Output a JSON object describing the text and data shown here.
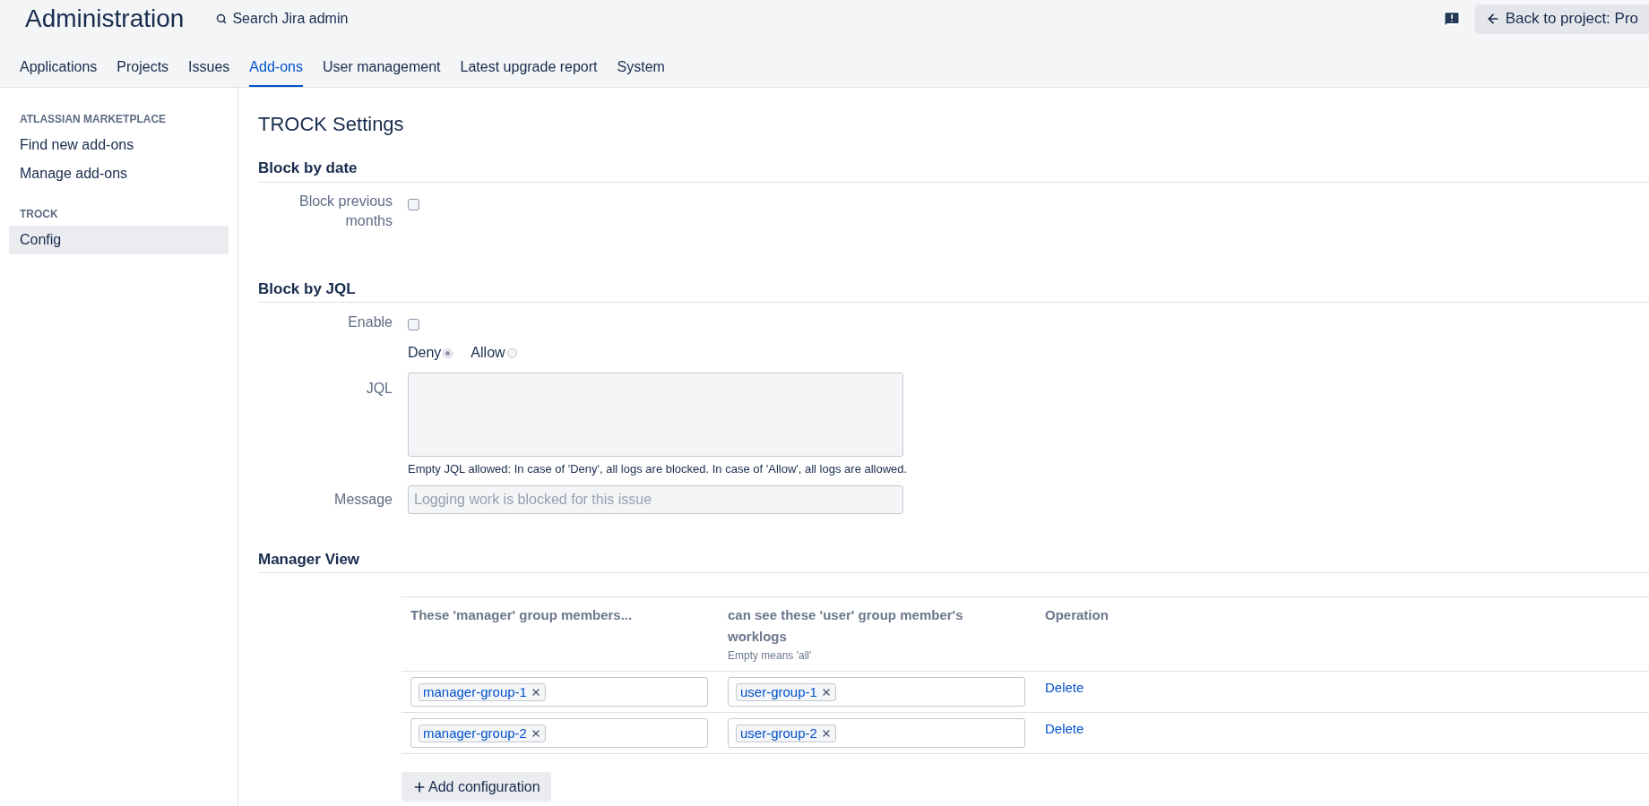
{
  "header": {
    "title": "Administration",
    "search": "Search Jira admin",
    "back_button": "Back to project: Pro"
  },
  "tabs": [
    {
      "label": "Applications",
      "selected": false
    },
    {
      "label": "Projects",
      "selected": false
    },
    {
      "label": "Issues",
      "selected": false
    },
    {
      "label": "Add-ons",
      "selected": true
    },
    {
      "label": "User management",
      "selected": false
    },
    {
      "label": "Latest upgrade report",
      "selected": false
    },
    {
      "label": "System",
      "selected": false
    }
  ],
  "sidebar": {
    "sections": [
      {
        "heading": "ATLASSIAN MARKETPLACE",
        "items": [
          {
            "label": "Find new add-ons",
            "selected": false
          },
          {
            "label": "Manage add-ons",
            "selected": false
          }
        ]
      },
      {
        "heading": "TROCK",
        "items": [
          {
            "label": "Config",
            "selected": true
          }
        ]
      }
    ]
  },
  "page_title": "TROCK Settings",
  "block_by_date": {
    "heading": "Block by date",
    "field": {
      "label": "Block previous months",
      "checked": false
    }
  },
  "block_by_jql": {
    "heading": "Block by JQL",
    "enable": {
      "label": "Enable",
      "checked": false
    },
    "modes": [
      {
        "label": "Deny",
        "selected": true
      },
      {
        "label": "Allow",
        "selected": false
      }
    ],
    "jql": {
      "label": "JQL"
    },
    "help": "Empty JQL allowed: In case of 'Deny', all logs are blocked. In case of 'Allow', all logs are allowed.",
    "message": {
      "label": "Message",
      "placeholder": "Logging work is blocked for this issue"
    }
  },
  "manager_view": {
    "heading": "Manager View",
    "columns": [
      {
        "label": "These 'manager' group members..."
      },
      {
        "label": "can see these 'user' group member's worklogs",
        "note": "Empty means 'all'"
      },
      {
        "label": "Operation"
      }
    ],
    "rows": [
      {
        "managers": [
          "manager-group-1"
        ],
        "users": [
          "user-group-1"
        ],
        "action": "Delete"
      },
      {
        "managers": [
          "manager-group-2"
        ],
        "users": [
          "user-group-2"
        ],
        "action": "Delete"
      }
    ],
    "add_button": "Add configuration"
  }
}
